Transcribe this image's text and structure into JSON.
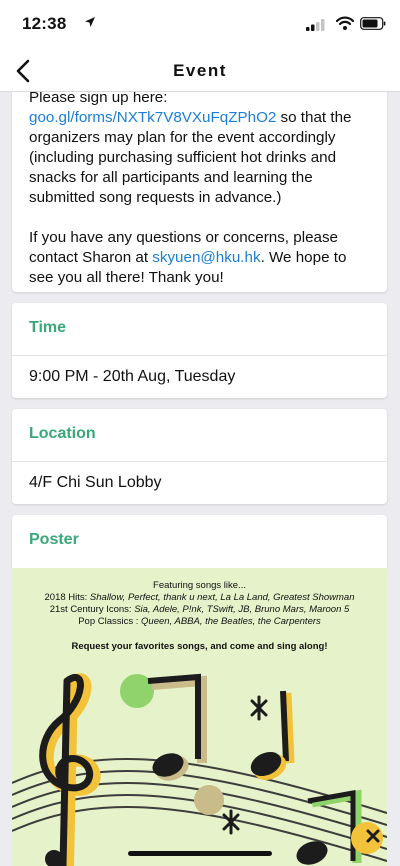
{
  "status_bar": {
    "time": "12:38"
  },
  "nav": {
    "title": "Event"
  },
  "description": {
    "line1_prefix": "Please sign up here: ",
    "signup_link": "goo.gl/forms/NXTk7V8VXuFqZPhO2",
    "line1_suffix": " so that the organizers may plan for the event accordingly (including purchasing sufficient hot drinks and snacks for all participants and learning the submitted song requests in advance.)",
    "line2_prefix": "If you have any questions or concerns, please contact Sharon at ",
    "email_link": "skyuen@hku.hk",
    "line2_suffix": ". We hope to see you all there! Thank you!"
  },
  "time_section": {
    "label": "Time",
    "value": "9:00 PM - 20th Aug, Tuesday"
  },
  "location_section": {
    "label": "Location",
    "value": "4/F Chi Sun Lobby"
  },
  "poster_section": {
    "label": "Poster"
  },
  "poster": {
    "heading": "Featuring songs like...",
    "row1_label": "2018 Hits: ",
    "row1_songs": "Shallow, Perfect, thank u next, La La Land, Greatest Showman",
    "row2_label": "21st Century Icons: ",
    "row2_songs": "Sia, Adele, P!nk, TSwift, JB, Bruno Mars, Maroon 5",
    "row3_label": "Pop Classics : ",
    "row3_songs": "Queen, ABBA, the Beatles, the Carpenters",
    "cta": "Request your favorites songs, and come and sing along!"
  },
  "colors": {
    "accent": "#3aa87a",
    "link": "#1b7fd6",
    "poster_bg": "#e6f2c9"
  },
  "icons": [
    "location-arrow-icon",
    "signal-icon",
    "wifi-icon",
    "battery-icon",
    "back-chevron-icon"
  ]
}
